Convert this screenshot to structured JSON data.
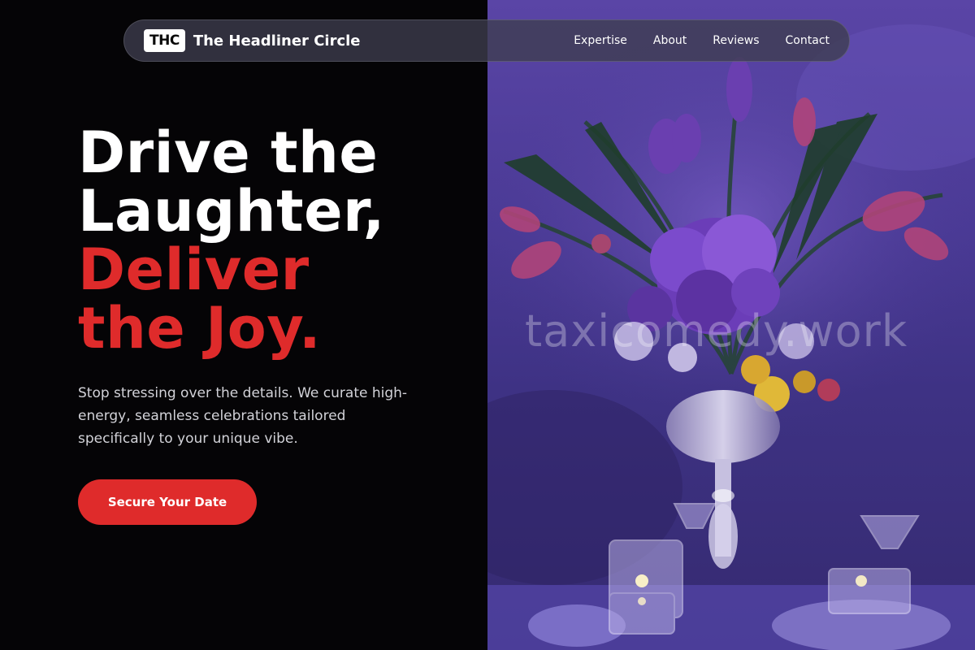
{
  "brand": {
    "logo_text": "THC",
    "name": "The Headliner Circle"
  },
  "nav": {
    "links": [
      {
        "label": "Expertise"
      },
      {
        "label": "About"
      },
      {
        "label": "Reviews"
      },
      {
        "label": "Contact"
      }
    ]
  },
  "hero": {
    "headline_line1": "Drive the",
    "headline_line2": "Laughter,",
    "headline_accent_line1": "Deliver",
    "headline_accent_line2": "the Joy.",
    "subtext": "Stop stressing over the details. We curate high-energy, seamless celebrations tailored specifically to your unique vibe.",
    "cta_label": "Secure Your Date"
  },
  "image": {
    "watermark": "taxicomedy.work",
    "icons": [
      "flower-centerpiece-image",
      "wine-glass-icon",
      "candle-holder-icon"
    ]
  },
  "colors": {
    "accent": "#df2b2b",
    "background": "#050406",
    "text_primary": "#ffffff",
    "text_secondary": "#d2d2d8",
    "image_tint": "#4a3a95"
  }
}
